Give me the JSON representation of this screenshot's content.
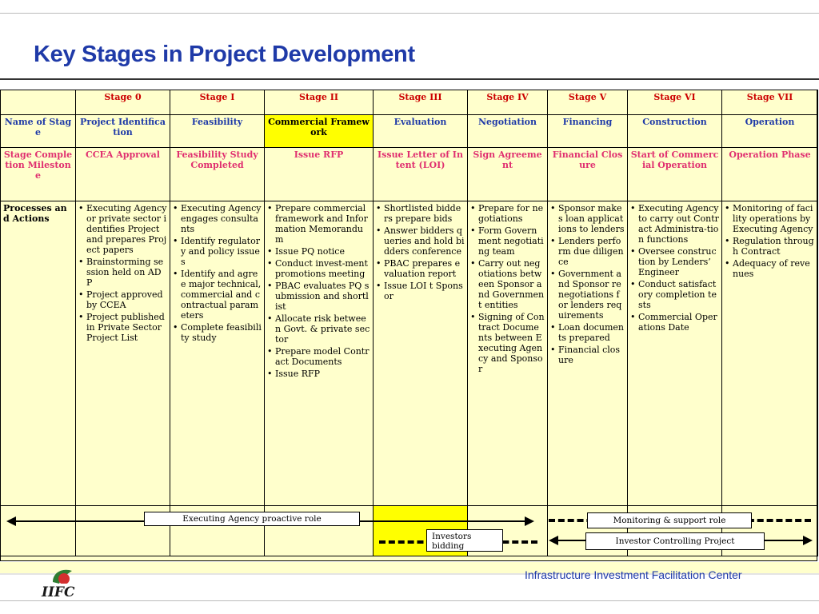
{
  "title": "Key Stages in Project Development",
  "stages": [
    "Stage 0",
    "Stage I",
    "Stage II",
    "Stage III",
    "Stage IV",
    "Stage V",
    "Stage VI",
    "Stage VII"
  ],
  "row_labels": {
    "name": "Name of Stage",
    "milestone": "Stage Completion Milestone",
    "process": "Processes and Actions"
  },
  "names": [
    "Project Identification",
    "Feasibility",
    "Commercial Framework",
    "Evaluation",
    "Negotiation",
    "Financing",
    "Construction",
    "Operation"
  ],
  "milestones": [
    "CCEA Approval",
    "Feasibility Study Completed",
    "Issue RFP",
    "Issue Letter of Intent (LOI)",
    "Sign Agreement",
    "Financial Closure",
    "Start of Commercial Operation",
    "Operation Phase"
  ],
  "actions": [
    [
      "Executing Agency or private sector identifies Project and prepares Project papers",
      "Brainstorming session held on ADP",
      "Project approved by CCEA",
      "Project published in Private Sector Project List"
    ],
    [
      "Executing Agency engages consultants",
      "Identify regulatory and policy issues",
      "Identify and agree major technical, commercial and contractual parameters",
      "Complete feasibility study"
    ],
    [
      "Prepare commercial framework and Information Memorandum",
      "Issue PQ notice",
      "Conduct invest-ment promotions meeting",
      "PBAC evaluates PQ submission and shortlist",
      "Allocate risk between Govt. & private sector",
      "Prepare model Contract Documents",
      "Issue RFP"
    ],
    [
      "Shortlisted bidders prepare bids",
      "Answer bidders queries and hold bidders conference",
      "PBAC prepares evaluation report",
      "Issue LOI t Sponsor"
    ],
    [
      "Prepare for negotiations",
      "Form Government negotiating team",
      "Carry out negotiations between Sponsor and Government entities",
      "Signing of Contract Documents between Executing Agency and Sponsor"
    ],
    [
      "Sponsor makes loan applications to lenders",
      "Lenders perform due diligence",
      "Government and Sponsor renegotiations for lenders requirements",
      "Loan documents prepared",
      "Financial closure"
    ],
    [
      "Executing Agency to carry out Contract Administra-tion functions",
      "Oversee construction by Lenders’ Engineer",
      "Conduct satisfactory completion tests",
      "Commercial Operations Date"
    ],
    [
      "Monitoring of facility operations by Executing Agency",
      "Regulation through Contract",
      "Adequacy of revenues"
    ]
  ],
  "roles": {
    "executing": "Executing Agency proactive role",
    "monitoring": "Monitoring  & support role",
    "investors_bidding": "Investors bidding",
    "investor_controlling": "Investor Controlling Project"
  },
  "footer": "Infrastructure Investment Facilitation Center",
  "logo_text": "IIFC",
  "colors": {
    "title": "#1f3aa8",
    "stage_header": "#cc0000",
    "milestone": "#e03070",
    "table_bg": "#ffffcc",
    "highlight": "#ffff00"
  }
}
